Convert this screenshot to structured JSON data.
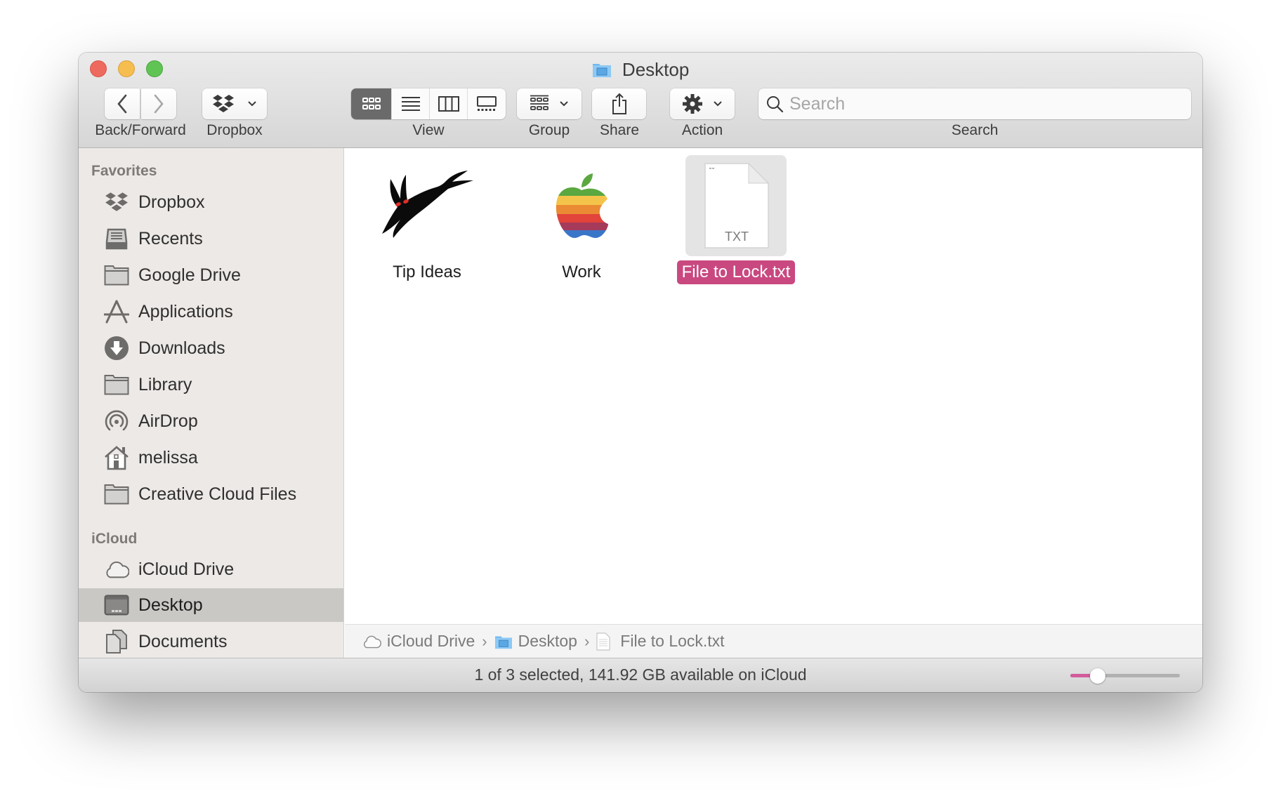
{
  "window": {
    "title": "Desktop",
    "title_icon": "desktop-folder-icon"
  },
  "toolbar": {
    "back_forward_label": "Back/Forward",
    "dropbox_label": "Dropbox",
    "view_label": "View",
    "view_modes": [
      {
        "name": "icon-view",
        "active": true
      },
      {
        "name": "list-view",
        "active": false
      },
      {
        "name": "column-view",
        "active": false
      },
      {
        "name": "gallery-view",
        "active": false
      }
    ],
    "group_label": "Group",
    "share_label": "Share",
    "action_label": "Action",
    "search_label": "Search",
    "search_placeholder": "Search",
    "search_value": ""
  },
  "sidebar": {
    "sections": [
      {
        "header": "Favorites",
        "items": [
          {
            "label": "Dropbox",
            "icon": "dropbox-icon"
          },
          {
            "label": "Recents",
            "icon": "recents-icon"
          },
          {
            "label": "Google Drive",
            "icon": "folder-icon"
          },
          {
            "label": "Applications",
            "icon": "applications-icon"
          },
          {
            "label": "Downloads",
            "icon": "downloads-icon"
          },
          {
            "label": "Library",
            "icon": "folder-icon"
          },
          {
            "label": "AirDrop",
            "icon": "airdrop-icon"
          },
          {
            "label": "melissa",
            "icon": "home-icon"
          },
          {
            "label": "Creative Cloud Files",
            "icon": "folder-icon"
          }
        ]
      },
      {
        "header": "iCloud",
        "items": [
          {
            "label": "iCloud Drive",
            "icon": "cloud-icon"
          },
          {
            "label": "Desktop",
            "icon": "desktop-icon",
            "selected": true
          },
          {
            "label": "Documents",
            "icon": "documents-icon"
          }
        ]
      }
    ]
  },
  "files": [
    {
      "name": "Tip Ideas",
      "icon": "rabbit-icon",
      "selected": false
    },
    {
      "name": "Work",
      "icon": "rainbow-apple-icon",
      "selected": false
    },
    {
      "name": "File to Lock.txt",
      "icon": "txt-file-icon",
      "file_type_label": "TXT",
      "selected": true
    }
  ],
  "path_bar": [
    {
      "label": "iCloud Drive",
      "icon": "cloud-icon"
    },
    {
      "label": "Desktop",
      "icon": "desktop-folder-icon"
    },
    {
      "label": "File to Lock.txt",
      "icon": "document-icon"
    }
  ],
  "status_bar": {
    "text": "1 of 3 selected, 141.92 GB available on iCloud",
    "icon_size_slider_fraction": 0.25
  },
  "colors": {
    "selection_label": "#c94880",
    "slider_fill": "#d15b9b",
    "sidebar_selected": "#cac8c5",
    "close": "#ee6a5e",
    "minimize": "#f6be4f",
    "zoom": "#5fc454"
  }
}
